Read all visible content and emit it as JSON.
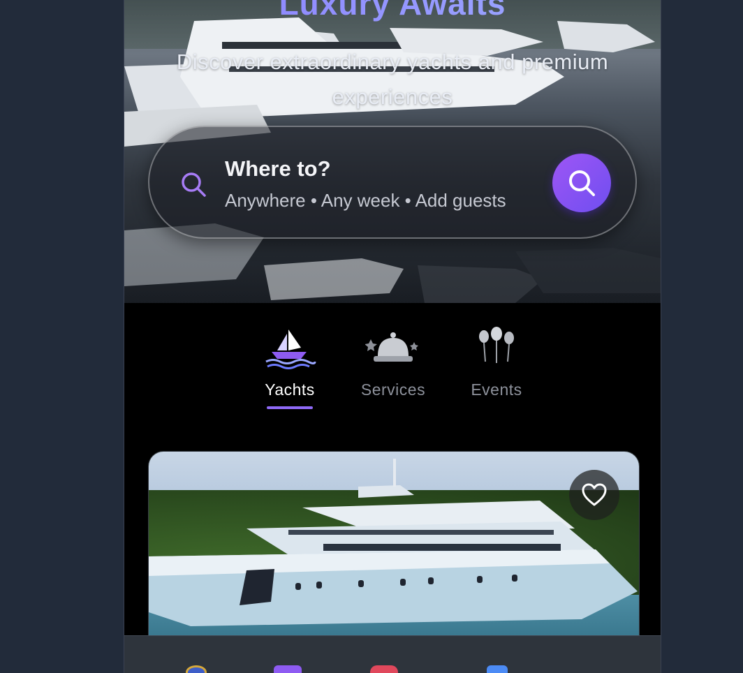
{
  "hero": {
    "title": "Luxury Awaits",
    "subtitle": "Discover extraordinary yachts and premium experiences"
  },
  "search": {
    "title": "Where to?",
    "meta": "Anywhere • Any week • Add guests",
    "accent_color": "#7b4ff0"
  },
  "categories": {
    "items": [
      {
        "label": "Yachts",
        "icon": "sailboat-icon",
        "active": true
      },
      {
        "label": "Services",
        "icon": "service-bell-icon",
        "active": false
      },
      {
        "label": "Events",
        "icon": "balloons-icon",
        "active": false
      }
    ],
    "active_color": "#8f6af7"
  },
  "listing": {
    "image": "yacht-photo",
    "favorite_icon": "heart-icon"
  },
  "bottom_nav": {
    "items": [
      {
        "icon": "explore-icon",
        "color": "#d7a93a"
      },
      {
        "icon": "calendar-icon",
        "color": "#8e5bf2"
      },
      {
        "icon": "favorites-icon",
        "color": "#e0485c"
      },
      {
        "icon": "profile-icon",
        "color": "#4c8bf5"
      }
    ]
  }
}
